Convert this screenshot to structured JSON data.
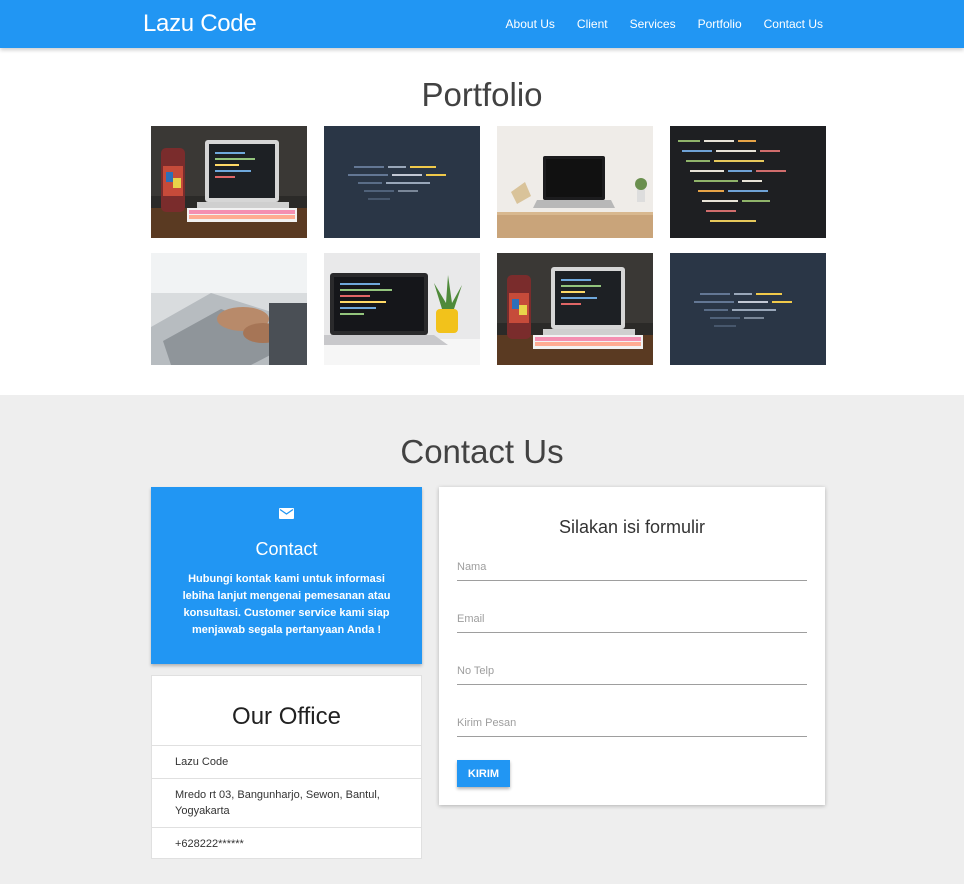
{
  "navbar": {
    "brand": "Lazu Code",
    "links": [
      "About Us",
      "Client",
      "Services",
      "Portfolio",
      "Contact Us"
    ]
  },
  "portfolio": {
    "title": "Portfolio",
    "images": [
      "laptop-desk-photo",
      "code-screen-blue-photo",
      "laptop-wall-photo",
      "code-screen-dark-photo",
      "typing-hands-photo",
      "laptop-plant-photo",
      "laptop-desk-photo",
      "code-screen-blue-photo"
    ]
  },
  "contact": {
    "title": "Contact Us",
    "info_card": {
      "icon": "mail-icon",
      "title": "Contact",
      "text": "Hubungi kontak kami untuk informasi lebiha lanjut mengenai pemesanan atau konsultasi. Customer service kami siap menjawab segala pertanyaan Anda !"
    },
    "office": {
      "title": "Our Office",
      "name": "Lazu Code",
      "address": "Mredo rt 03, Bangunharjo, Sewon, Bantul, Yogyakarta",
      "phone": "+628222******"
    },
    "form": {
      "title": "Silakan isi formulir",
      "name_placeholder": "Nama",
      "email_placeholder": "Email",
      "phone_placeholder": "No Telp",
      "message_placeholder": "Kirim Pesan",
      "submit_label": "KIRIM"
    }
  }
}
